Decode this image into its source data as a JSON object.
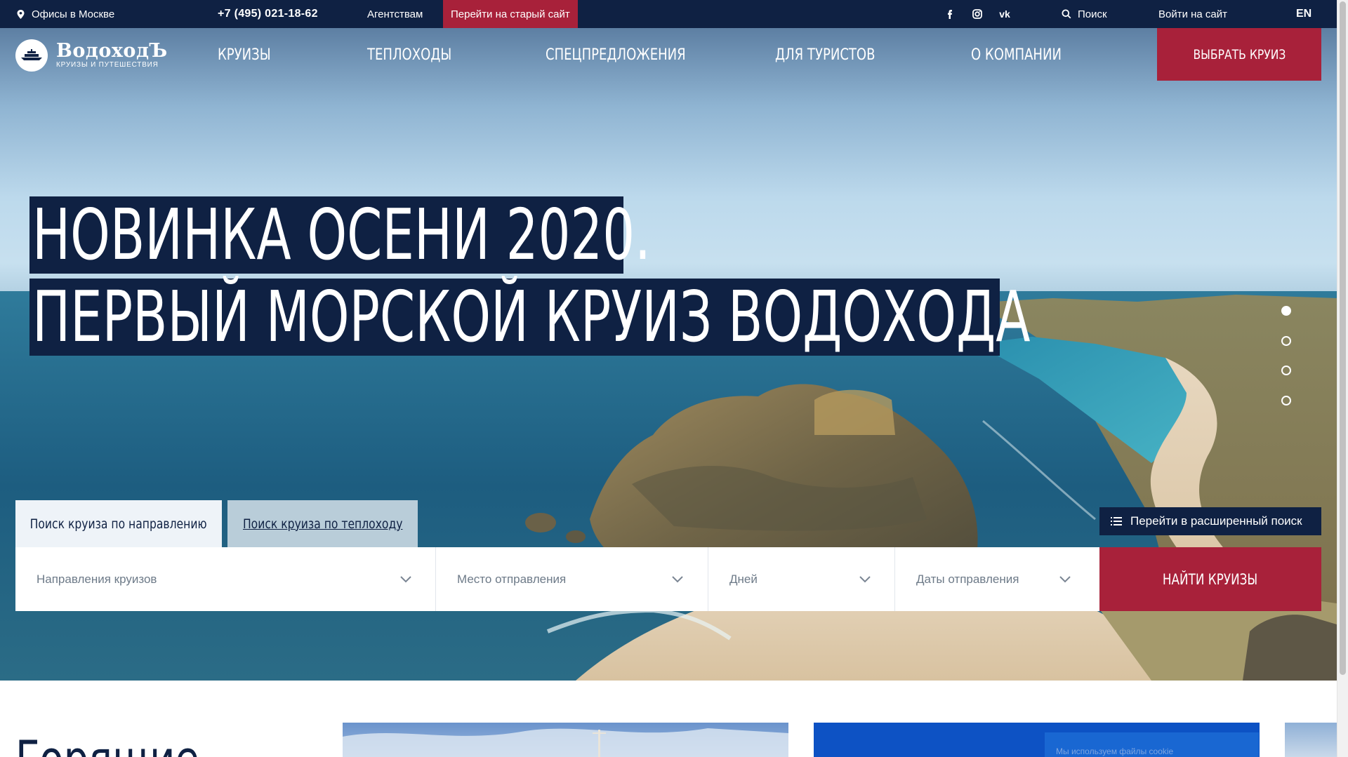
{
  "topbar": {
    "offices": "Офисы в Москве",
    "phone": "+7 (495) 021-18-62",
    "agencies": "Агентствам",
    "old_site": "Перейти на старый сайт",
    "social_vk": "vk",
    "search": "Поиск",
    "login": "Войти на сайт",
    "lang": "EN"
  },
  "logo": {
    "brand": "ВодоходЪ",
    "tagline": "КРУИЗЫ И ПУТЕШЕСТВИЯ"
  },
  "nav": {
    "items": [
      "КРУИЗЫ",
      "ТЕПЛОХОДЫ",
      "СПЕЦПРЕДЛОЖЕНИЯ",
      "ДЛЯ ТУРИСТОВ",
      "О КОМПАНИИ"
    ],
    "cta": "ВЫБРАТЬ КРУИЗ"
  },
  "hero": {
    "line1": "НОВИНКА ОСЕНИ 2020.",
    "line2": "ПЕРВЫЙ МОРСКОЙ КРУИЗ ВОДОХОДА",
    "slides_total": 4,
    "active_slide": 1
  },
  "search": {
    "tabs": [
      "Поиск круиза по направлению",
      "Поиск круиза по теплоходу"
    ],
    "active_tab": 0,
    "advanced": "Перейти в расширенный поиск",
    "fields": {
      "direction": "Направления круизов",
      "departure_place": "Место отправления",
      "days": "Дней",
      "dates": "Даты отправления"
    },
    "submit": "НАЙТИ КРУИЗЫ"
  },
  "below": {
    "title": "Горящие",
    "cookie_text": "Мы используем файлы cookie"
  },
  "colors": {
    "navy": "#0f2143",
    "accent": "#a8213a",
    "tab_active": "#eef3f8",
    "tab_inactive": "#b9cdd9"
  },
  "icons": [
    "location-pin-icon",
    "facebook-icon",
    "instagram-icon",
    "vk-icon",
    "search-icon",
    "ship-logo-icon",
    "list-icon",
    "chevron-down-icon"
  ]
}
